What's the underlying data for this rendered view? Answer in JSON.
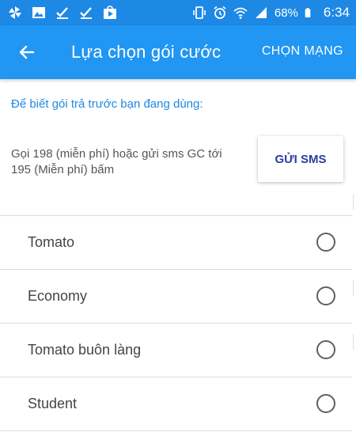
{
  "status_bar": {
    "left_icons": [
      "pinwheel-icon",
      "image-icon",
      "check-download-icon",
      "check-download-icon",
      "play-store-icon"
    ],
    "right_icons": [
      "vibrate-icon",
      "alarm-icon",
      "wifi-icon",
      "signal-icon",
      "battery-icon"
    ],
    "battery_percent": "68%",
    "time": "6:34",
    "background_color": "#1e88e5"
  },
  "app_bar": {
    "back_icon": "arrow-back-icon",
    "title": "Lựa chọn gói cước",
    "action_label": "CHỌN MẠNG",
    "background_color": "#2196f3"
  },
  "info": {
    "heading": "Để biết gói trả trước bạn đang dùng:",
    "sms_description": "Gọi 198 (miễn phí) hoặc gửi sms GC tới 195 (Miễn phí) bấm",
    "sms_button_label": "GỬI SMS"
  },
  "plans": [
    {
      "label": "Tomato",
      "selected": false
    },
    {
      "label": "Economy",
      "selected": false
    },
    {
      "label": "Tomato buôn làng",
      "selected": false
    },
    {
      "label": "Student",
      "selected": false
    }
  ]
}
